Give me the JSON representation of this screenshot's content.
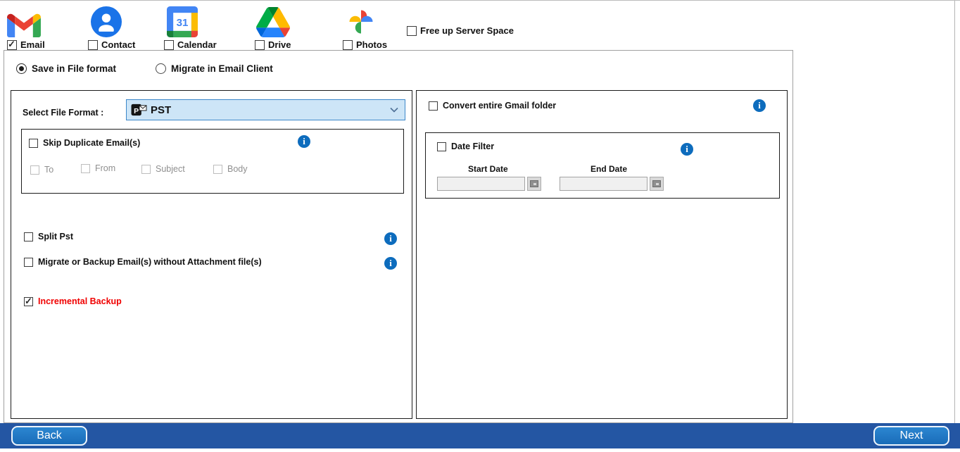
{
  "colors": {
    "info_icon_blue": "#0d6cbd",
    "select_bg": "#cde5f7",
    "select_border": "#3c87c9",
    "incremental_red": "#f00000",
    "footer_bar_blue": "#2456a3",
    "footer_button_blue": "#1d76c4"
  },
  "top_nav": {
    "items": [
      {
        "label": "Email",
        "icon": "gmail-icon",
        "checked": true
      },
      {
        "label": "Contact",
        "icon": "google-contacts-icon",
        "checked": false
      },
      {
        "label": "Calendar",
        "icon": "google-calendar-icon",
        "icon_text": "31",
        "checked": false
      },
      {
        "label": "Drive",
        "icon": "google-drive-icon",
        "checked": false
      },
      {
        "label": "Photos",
        "icon": "google-photos-icon",
        "checked": false
      }
    ],
    "free_up_server_space_label": "Free up Server Space",
    "free_up_server_space_checked": false
  },
  "mode_selector": {
    "options": [
      {
        "label": "Save in File format",
        "selected": true
      },
      {
        "label": "Migrate in Email Client",
        "selected": false
      }
    ]
  },
  "left_panel": {
    "select_file_format_label": "Select File Format  :",
    "selected_format": "PST",
    "pst_icon_letter": "P",
    "skip_duplicate": {
      "label": "Skip Duplicate Email(s)",
      "checked": false,
      "fields": [
        "To",
        "From",
        "Subject",
        "Body"
      ]
    },
    "split_pst": {
      "label": "Split Pst",
      "checked": false
    },
    "without_attachments": {
      "label": "Migrate or Backup Email(s) without Attachment file(s)",
      "checked": false
    },
    "incremental_backup": {
      "label": "Incremental Backup",
      "checked": true
    }
  },
  "right_panel": {
    "convert_entire_folder": {
      "label": "Convert entire Gmail folder",
      "checked": false
    },
    "date_filter": {
      "label": "Date Filter",
      "checked": false,
      "start_date_label": "Start Date",
      "end_date_label": "End Date",
      "start_date_value": "",
      "end_date_value": ""
    }
  },
  "footer": {
    "back_label": "Back",
    "next_label": "Next"
  }
}
